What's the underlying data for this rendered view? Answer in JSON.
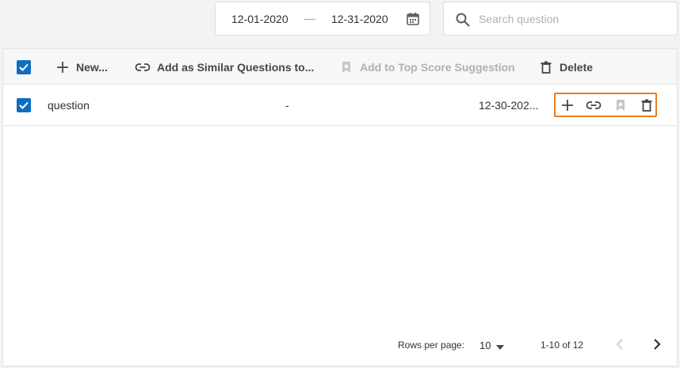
{
  "date_range": {
    "from": "12-01-2020",
    "separator": "—",
    "to": "12-31-2020"
  },
  "search": {
    "placeholder": "Search question",
    "value": ""
  },
  "toolbar": {
    "new_label": "New...",
    "similar_label": "Add as Similar Questions to...",
    "top_score_label": "Add to Top Score Suggestion",
    "delete_label": "Delete"
  },
  "rows": [
    {
      "question": "question",
      "answer": "-",
      "date": "12-30-202...",
      "selected": true
    }
  ],
  "footer": {
    "rows_per_page_label": "Rows per page:",
    "rows_per_page_value": "10",
    "range_text": "1-10 of 12"
  },
  "icons": {
    "toolbar": [
      "check-icon",
      "plus-icon",
      "link-icon",
      "bookmark-star-icon",
      "trash-icon"
    ],
    "row_actions": [
      "plus-icon",
      "link-icon",
      "bookmark-star-icon",
      "trash-icon"
    ],
    "header": [
      "calendar-icon",
      "search-icon"
    ],
    "footer": [
      "chevron-down-icon",
      "chevron-left-icon",
      "chevron-right-icon"
    ]
  },
  "colors": {
    "accent": "#106ebe",
    "highlight_border": "#e67e22",
    "disabled": "#b3b0ad"
  }
}
